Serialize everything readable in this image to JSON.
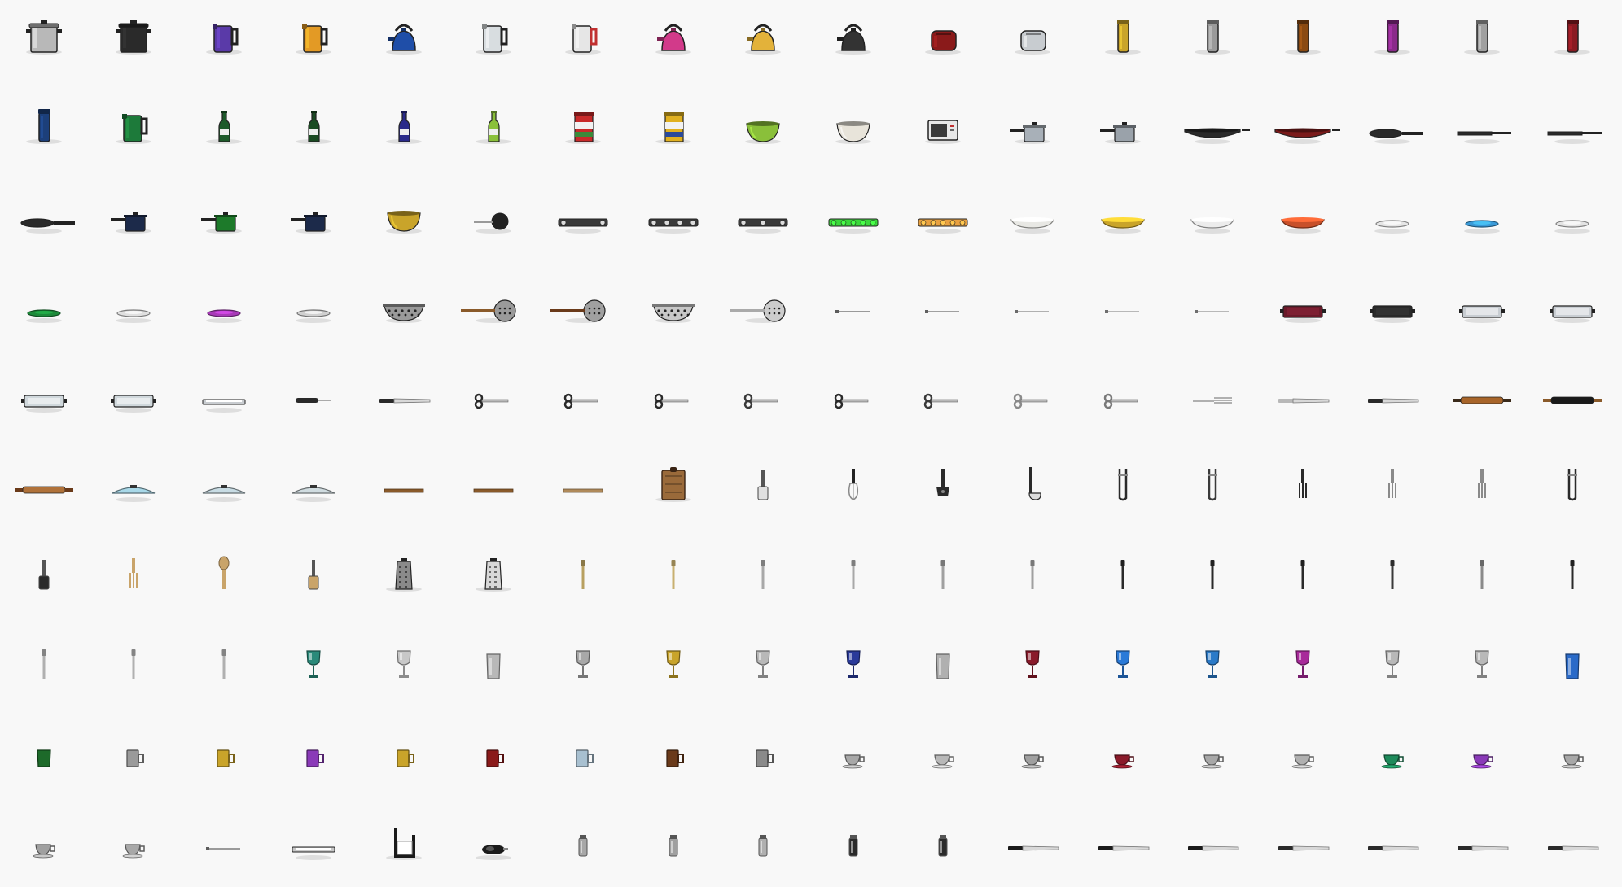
{
  "sheet": {
    "background": "#f8f8f8",
    "columns": 18,
    "rows": 10
  },
  "items": [
    {
      "name": "stockpot-icon",
      "shape": "pot",
      "c": "#b8b8b8"
    },
    {
      "name": "dutch-oven-icon",
      "shape": "pot",
      "c": "#2a2a2a"
    },
    {
      "name": "purple-kettle-icon",
      "shape": "kettle",
      "c": "#5a3aa8"
    },
    {
      "name": "orange-kettle-icon",
      "shape": "kettle",
      "c": "#e39a25"
    },
    {
      "name": "blue-kettle-icon",
      "shape": "teakettle",
      "c": "#1f4ea8"
    },
    {
      "name": "glass-kettle-icon",
      "shape": "kettle",
      "c": "#d8dde0"
    },
    {
      "name": "red-kettle-icon",
      "shape": "kettle",
      "c": "#e6e6e6",
      "c2": "#c03030"
    },
    {
      "name": "pink-teakettle-icon",
      "shape": "teakettle",
      "c": "#d23a8a"
    },
    {
      "name": "yellow-teakettle-icon",
      "shape": "teakettle",
      "c": "#e3b23a"
    },
    {
      "name": "stovetop-kettle-icon",
      "shape": "teakettle",
      "c": "#333333"
    },
    {
      "name": "red-toaster-icon",
      "shape": "toaster",
      "c": "#8a1a1a"
    },
    {
      "name": "silver-toaster-icon",
      "shape": "toaster",
      "c": "#c8ccd0"
    },
    {
      "name": "gold-thermos-icon",
      "shape": "thermos",
      "c": "#c9a42a"
    },
    {
      "name": "steel-thermos-icon",
      "shape": "thermos",
      "c": "#9a9a9a"
    },
    {
      "name": "coffee-carafe-icon",
      "shape": "thermos",
      "c": "#8a4a12"
    },
    {
      "name": "purple-flask-icon",
      "shape": "thermos",
      "c": "#8a2a8a"
    },
    {
      "name": "silver-flask-icon",
      "shape": "thermos",
      "c": "#a0a0a0"
    },
    {
      "name": "red-travel-mug-icon",
      "shape": "thermos",
      "c": "#8a1a22"
    },
    {
      "name": "blue-travel-mug-icon",
      "shape": "thermos",
      "c": "#1c3f7a"
    },
    {
      "name": "green-pitcher-icon",
      "shape": "kettle",
      "c": "#1d7a3a"
    },
    {
      "name": "green-wine-bottle-icon",
      "shape": "bottle",
      "c": "#1d5a2a"
    },
    {
      "name": "dark-green-bottle-icon",
      "shape": "bottle",
      "c": "#1a4a22"
    },
    {
      "name": "blue-bottle-icon",
      "shape": "bottle",
      "c": "#2a2a8a"
    },
    {
      "name": "oil-bottle-icon",
      "shape": "bottle",
      "c": "#8ac03a"
    },
    {
      "name": "spice-tin-icon",
      "shape": "tin",
      "c": "#c82a2a",
      "c2": "#3a8a3a"
    },
    {
      "name": "yellow-canister-icon",
      "shape": "tin",
      "c": "#e0b020",
      "c2": "#2a4a9a"
    },
    {
      "name": "green-mixing-bowl-icon",
      "shape": "bowl",
      "c": "#8ac03a"
    },
    {
      "name": "white-bowl-icon",
      "shape": "bowl",
      "c": "#e8e4da"
    },
    {
      "name": "microwave-icon",
      "shape": "microwave",
      "c": "#e8e8e8"
    },
    {
      "name": "saucepan-icon",
      "shape": "saucepan",
      "c": "#a8b0b8"
    },
    {
      "name": "steel-saucepan-icon",
      "shape": "saucepan",
      "c": "#9aa2aa"
    },
    {
      "name": "black-wok-icon",
      "shape": "wok",
      "c": "#2a2a2a"
    },
    {
      "name": "red-wok-icon",
      "shape": "wok",
      "c": "#7a1a1a"
    },
    {
      "name": "frying-pan-icon",
      "shape": "pan",
      "c": "#2a2a2a"
    },
    {
      "name": "crepe-pan-icon",
      "shape": "flatpan",
      "c": "#2a2a2a"
    },
    {
      "name": "griddle-pan-icon",
      "shape": "flatpan",
      "c": "#2a2a2a"
    },
    {
      "name": "skillet-icon",
      "shape": "pan",
      "c": "#2a2a2a"
    },
    {
      "name": "navy-saucepan-icon",
      "shape": "saucepan",
      "c": "#1c2a4a"
    },
    {
      "name": "green-saucepan-icon",
      "shape": "saucepan",
      "c": "#1d7a2a"
    },
    {
      "name": "small-navy-pot-icon",
      "shape": "saucepan",
      "c": "#1c2a4a"
    },
    {
      "name": "brass-pot-icon",
      "shape": "bowl",
      "c": "#c9a42a"
    },
    {
      "name": "ladle-pan-icon",
      "shape": "roundpan",
      "c": "#222222"
    },
    {
      "name": "double-burner-icon",
      "shape": "burner",
      "c": "#2a2a2a",
      "n": 2
    },
    {
      "name": "four-cup-tray-icon",
      "shape": "burner",
      "c": "#2a2a2a",
      "n": 4
    },
    {
      "name": "gas-hob-icon",
      "shape": "burner",
      "c": "#3a3a3a",
      "n": 3
    },
    {
      "name": "green-egg-tray-icon",
      "shape": "burner",
      "c": "#3ad83a",
      "n": 5
    },
    {
      "name": "orange-tray-icon",
      "shape": "burner",
      "c": "#e8a040",
      "n": 5
    },
    {
      "name": "white-serving-dish-icon",
      "shape": "dish",
      "c": "#e8e8e4"
    },
    {
      "name": "gold-serving-dish-icon",
      "shape": "dish",
      "c": "#c9a42a"
    },
    {
      "name": "white-platter-icon",
      "shape": "dish",
      "c": "#ececec"
    },
    {
      "name": "orange-platter-icon",
      "shape": "dish",
      "c": "#c8502a"
    },
    {
      "name": "white-plate-icon",
      "shape": "plate",
      "c": "#e6e6e6"
    },
    {
      "name": "blue-plate-icon",
      "shape": "plate",
      "c": "#3a9ad8"
    },
    {
      "name": "white-saucer-icon",
      "shape": "plate",
      "c": "#e4e4e4"
    },
    {
      "name": "green-saucer-icon",
      "shape": "plate",
      "c": "#1d8a3a"
    },
    {
      "name": "white-flat-plate-icon",
      "shape": "plate",
      "c": "#e0e0e0"
    },
    {
      "name": "purple-saucer-icon",
      "shape": "plate",
      "c": "#a83ab8"
    },
    {
      "name": "small-saucer-icon",
      "shape": "plate",
      "c": "#d0d0d0"
    },
    {
      "name": "colander-icon",
      "shape": "colander",
      "c": "#9a9a9a"
    },
    {
      "name": "large-strainer-icon",
      "shape": "strainer",
      "c": "#9a9a9a",
      "c2": "#8a5a2a"
    },
    {
      "name": "mesh-strainer-icon",
      "shape": "strainer",
      "c": "#a0a0a0",
      "c2": "#6a3a1a"
    },
    {
      "name": "sieve-icon",
      "shape": "colander",
      "c": "#c8c8c8"
    },
    {
      "name": "fine-sieve-icon",
      "shape": "strainer",
      "c": "#cccccc",
      "c2": "#aaaaaa"
    },
    {
      "name": "skewer-icon",
      "shape": "stick",
      "c": "#9a9a9a"
    },
    {
      "name": "skewer-long-icon",
      "shape": "stick",
      "c": "#a0a0a0"
    },
    {
      "name": "cake-tester-icon",
      "shape": "stick",
      "c": "#b0b0b0"
    },
    {
      "name": "pin-icon",
      "shape": "stick",
      "c": "#b8b8b8"
    },
    {
      "name": "needle-icon",
      "shape": "stick",
      "c": "#b8b8b8"
    },
    {
      "name": "maroon-baking-tray-icon",
      "shape": "tray",
      "c": "#6a1a2a"
    },
    {
      "name": "black-baking-tray-icon",
      "shape": "tray",
      "c": "#2a2a2a"
    },
    {
      "name": "silver-roasting-tray-icon",
      "shape": "tray",
      "c": "#c8cdd2"
    },
    {
      "name": "silver-tray-icon",
      "shape": "tray",
      "c": "#c8cdd2"
    },
    {
      "name": "glass-dish-icon",
      "shape": "tray",
      "c": "#d0d8dc"
    },
    {
      "name": "glass-pan-icon",
      "shape": "tray",
      "c": "#d0d8dc"
    },
    {
      "name": "sheet-pan-icon",
      "shape": "flattray",
      "c": "#c8ccd0"
    },
    {
      "name": "peeler-icon",
      "shape": "peeler",
      "c": "#2a2a2a"
    },
    {
      "name": "paring-knife-icon",
      "shape": "knife",
      "c": "#2a2a2a"
    },
    {
      "name": "scissors-icon",
      "shape": "scissors",
      "c": "#2a2a2a"
    },
    {
      "name": "kitchen-shears-icon",
      "shape": "scissors",
      "c": "#2a2a2a"
    },
    {
      "name": "poultry-shears-icon",
      "shape": "scissors",
      "c": "#2a2a2a"
    },
    {
      "name": "trimming-scissors-icon",
      "shape": "scissors",
      "c": "#3a3a3a"
    },
    {
      "name": "herb-scissors-icon",
      "shape": "scissors",
      "c": "#2a2a2a"
    },
    {
      "name": "snips-icon",
      "shape": "scissors",
      "c": "#3a3a3a"
    },
    {
      "name": "silver-scissors-icon",
      "shape": "scissors",
      "c": "#8a8a8a"
    },
    {
      "name": "craft-scissors-icon",
      "shape": "scissors",
      "c": "#7a7a7a"
    },
    {
      "name": "fork-icon",
      "shape": "fork-h",
      "c": "#b0b0b0"
    },
    {
      "name": "spreader-icon",
      "shape": "knife",
      "c": "#b8b8b8"
    },
    {
      "name": "bread-knife-icon",
      "shape": "knife",
      "c": "#2a2a2a"
    },
    {
      "name": "wooden-rolling-pin-icon",
      "shape": "rollingpin",
      "c": "#a8652a",
      "c2": "#3a2a1a"
    },
    {
      "name": "black-rolling-pin-icon",
      "shape": "rollingpin",
      "c": "#1a1a1a",
      "c2": "#8a5a2a"
    },
    {
      "name": "rolling-pin-icon",
      "shape": "rollingpin",
      "c": "#b0723a",
      "c2": "#6a3a1a"
    },
    {
      "name": "glass-lid-icon",
      "shape": "lid",
      "c": "#a8d8e8"
    },
    {
      "name": "clear-lid-icon",
      "shape": "lid",
      "c": "#c8dce4"
    },
    {
      "name": "small-lid-icon",
      "shape": "lid",
      "c": "#d0dce0"
    },
    {
      "name": "wooden-board-icon",
      "shape": "plank",
      "c": "#8a5a2a"
    },
    {
      "name": "chopping-plank-icon",
      "shape": "plank",
      "c": "#8a5a2a"
    },
    {
      "name": "wooden-skewer-icon",
      "shape": "plank",
      "c": "#b08a5a"
    },
    {
      "name": "cutting-board-icon",
      "shape": "board",
      "c": "#9a6a3a"
    },
    {
      "name": "spatula-icon",
      "shape": "spatula",
      "c": "#e0e0e0"
    },
    {
      "name": "whisk-icon",
      "shape": "whisk",
      "c": "#8a8a8a"
    },
    {
      "name": "masher-icon",
      "shape": "masher",
      "c": "#2a2a2a"
    },
    {
      "name": "ladle-icon",
      "shape": "ladle",
      "c": "#2a2a2a"
    },
    {
      "name": "tongs-icon",
      "shape": "tongs",
      "c": "#2a2a2a"
    },
    {
      "name": "silver-tongs-icon",
      "shape": "tongs",
      "c": "#3a3a3a"
    },
    {
      "name": "serving-fork-icon",
      "shape": "fork-v",
      "c": "#2a2a2a"
    },
    {
      "name": "carving-fork-icon",
      "shape": "fork-v",
      "c": "#8a8a8a"
    },
    {
      "name": "meat-fork-icon",
      "shape": "fork-v",
      "c": "#8a8a8a"
    },
    {
      "name": "salad-tongs-icon",
      "shape": "tongs",
      "c": "#2a2a2a"
    },
    {
      "name": "turner-icon",
      "shape": "spatula",
      "c": "#2a2a2a"
    },
    {
      "name": "wooden-fork-icon",
      "shape": "fork-v",
      "c": "#c9a46a"
    },
    {
      "name": "wooden-spoon-icon",
      "shape": "spoon",
      "c": "#c9a46a"
    },
    {
      "name": "wooden-spatula-icon",
      "shape": "spatula",
      "c": "#c9a46a"
    },
    {
      "name": "box-grater-icon",
      "shape": "grater",
      "c": "#8a8a8a"
    },
    {
      "name": "white-grater-icon",
      "shape": "grater",
      "c": "#d8d8d8"
    },
    {
      "name": "butter-knife-icon",
      "shape": "vutensil",
      "c": "#b8a060"
    },
    {
      "name": "dinner-knife-icon",
      "shape": "vutensil",
      "c": "#c8b070"
    },
    {
      "name": "table-fork-icon",
      "shape": "vutensil",
      "c": "#a8a8a8"
    },
    {
      "name": "table-knife-icon",
      "shape": "vutensil",
      "c": "#a8a8a8"
    },
    {
      "name": "teaspoon-icon",
      "shape": "vutensil",
      "c": "#a0a0a0"
    },
    {
      "name": "dessert-spoon-icon",
      "shape": "vutensil",
      "c": "#a0a0a0"
    },
    {
      "name": "steak-knife-icon",
      "shape": "vutensil",
      "c": "#2a2a2a"
    },
    {
      "name": "chef-knife-icon",
      "shape": "vutensil",
      "c": "#2a2a2a"
    },
    {
      "name": "utility-knife-icon",
      "shape": "vutensil",
      "c": "#2a2a2a"
    },
    {
      "name": "boning-knife-icon",
      "shape": "vutensil",
      "c": "#3a3a3a"
    },
    {
      "name": "pizza-cutter-icon",
      "shape": "vutensil",
      "c": "#8a8a8a"
    },
    {
      "name": "cleaver-icon",
      "shape": "vutensil",
      "c": "#2a2a2a"
    },
    {
      "name": "silver-fork-icon",
      "shape": "vutensil",
      "c": "#b0b0b0"
    },
    {
      "name": "silver-spoon-icon",
      "shape": "vutensil",
      "c": "#b0b0b0"
    },
    {
      "name": "silver-knife-icon",
      "shape": "vutensil",
      "c": "#b0b0b0"
    },
    {
      "name": "teal-wine-glass-icon",
      "shape": "wineglass",
      "c": "#2a8a7a"
    },
    {
      "name": "clear-wine-glass-icon",
      "shape": "wineglass",
      "c": "#c8c8c8"
    },
    {
      "name": "tumbler-icon",
      "shape": "tumbler",
      "c": "#b8b8b8"
    },
    {
      "name": "goblet-icon",
      "shape": "wineglass",
      "c": "#a8a8a8"
    },
    {
      "name": "gold-goblet-icon",
      "shape": "wineglass",
      "c": "#c9a42a"
    },
    {
      "name": "coupe-glass-icon",
      "shape": "wineglass",
      "c": "#b8b8b8"
    },
    {
      "name": "blue-wine-glass-icon",
      "shape": "wineglass",
      "c": "#2a3a9a"
    },
    {
      "name": "highball-glass-icon",
      "shape": "tumbler",
      "c": "#b0b0b0"
    },
    {
      "name": "red-wine-glass-icon",
      "shape": "wineglass",
      "c": "#8a1a2a"
    },
    {
      "name": "blue-goblet-icon",
      "shape": "wineglass",
      "c": "#2a7ad8"
    },
    {
      "name": "blue-cocktail-glass-icon",
      "shape": "wineglass",
      "c": "#2a7ac8"
    },
    {
      "name": "magenta-glass-icon",
      "shape": "wineglass",
      "c": "#a82a9a"
    },
    {
      "name": "snifter-icon",
      "shape": "wineglass",
      "c": "#b8b8b8"
    },
    {
      "name": "small-snifter-icon",
      "shape": "wineglass",
      "c": "#b8b8b8"
    },
    {
      "name": "blue-tumbler-icon",
      "shape": "tumbler",
      "c": "#2a6ac8"
    },
    {
      "name": "green-cup-icon",
      "shape": "cup",
      "c": "#1d6a2a"
    },
    {
      "name": "steel-mug-icon",
      "shape": "mug",
      "c": "#9a9a9a"
    },
    {
      "name": "yellow-mug-icon",
      "shape": "mug",
      "c": "#c9a42a"
    },
    {
      "name": "purple-mug-icon",
      "shape": "mug",
      "c": "#8a3ab8"
    },
    {
      "name": "gold-mug-icon",
      "shape": "mug",
      "c": "#c9a42a"
    },
    {
      "name": "red-mug-icon",
      "shape": "mug",
      "c": "#8a1a1a"
    },
    {
      "name": "pale-blue-mug-icon",
      "shape": "mug",
      "c": "#a8c0d0"
    },
    {
      "name": "brown-mug-icon",
      "shape": "mug",
      "c": "#6a3a1a"
    },
    {
      "name": "beer-stein-icon",
      "shape": "mug",
      "c": "#8a8a8a"
    },
    {
      "name": "teacup-icon",
      "shape": "teacup",
      "c": "#a8a8a8"
    },
    {
      "name": "white-teacup-icon",
      "shape": "teacup",
      "c": "#b8b8b8"
    },
    {
      "name": "grey-teacup-icon",
      "shape": "teacup",
      "c": "#a0a0a0"
    },
    {
      "name": "red-teacup-icon",
      "shape": "teacup",
      "c": "#8a1a2a"
    },
    {
      "name": "silver-cup-icon",
      "shape": "teacup",
      "c": "#a8a8a8"
    },
    {
      "name": "espresso-cup-icon",
      "shape": "teacup",
      "c": "#b0b0b0"
    },
    {
      "name": "green-teacup-icon",
      "shape": "teacup",
      "c": "#1d8a5a"
    },
    {
      "name": "purple-teacup-icon",
      "shape": "teacup",
      "c": "#8a3ab8"
    },
    {
      "name": "small-espresso-cup-icon",
      "shape": "teacup",
      "c": "#a8a8a8"
    },
    {
      "name": "creamer-icon",
      "shape": "teacup",
      "c": "#a0a0a0"
    },
    {
      "name": "sugar-bowl-icon",
      "shape": "teacup",
      "c": "#a8a8a8"
    },
    {
      "name": "baster-icon",
      "shape": "stick",
      "c": "#9a9a9a"
    },
    {
      "name": "pastry-brush-icon",
      "shape": "flattray",
      "c": "#c8c8c8"
    },
    {
      "name": "napkin-holder-icon",
      "shape": "holder",
      "c": "#1a1a1a"
    },
    {
      "name": "tape-dispenser-icon",
      "shape": "dispenser",
      "c": "#1a1a1a"
    },
    {
      "name": "salt-shaker-icon",
      "shape": "shaker",
      "c": "#a8a8a8"
    },
    {
      "name": "pepper-shaker-icon",
      "shape": "shaker",
      "c": "#a0a0a0"
    },
    {
      "name": "oil-cruet-icon",
      "shape": "shaker",
      "c": "#b0b0b0"
    },
    {
      "name": "vinegar-cruet-icon",
      "shape": "shaker",
      "c": "#2a2a2a"
    },
    {
      "name": "spice-jar-icon",
      "shape": "shaker",
      "c": "#2a2a2a"
    },
    {
      "name": "santoku-knife-icon",
      "shape": "knife",
      "c": "#1a1a1a"
    },
    {
      "name": "carving-knife-icon",
      "shape": "knife",
      "c": "#1a1a1a"
    },
    {
      "name": "fillet-knife-icon",
      "shape": "knife",
      "c": "#1a1a1a"
    },
    {
      "name": "slicing-knife-icon",
      "shape": "knife",
      "c": "#2a2a2a"
    },
    {
      "name": "nakiri-knife-icon",
      "shape": "knife",
      "c": "#2a2a2a"
    },
    {
      "name": "petty-knife-icon",
      "shape": "knife",
      "c": "#2a2a2a"
    },
    {
      "name": "sushi-knife-icon",
      "shape": "knife",
      "c": "#2a2a2a"
    }
  ]
}
